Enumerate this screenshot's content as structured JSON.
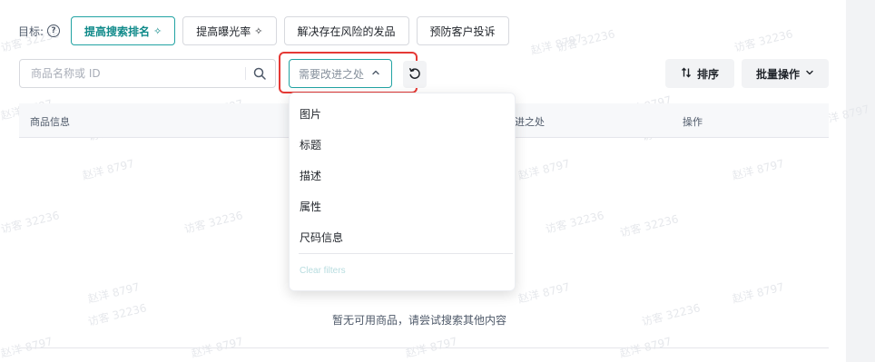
{
  "goal": {
    "label": "目标:",
    "buttons": [
      {
        "label": "提高搜索排名",
        "active": true
      },
      {
        "label": "提高曝光率",
        "active": false
      },
      {
        "label": "解决存在风险的发品",
        "active": false
      },
      {
        "label": "预防客户投诉",
        "active": false
      }
    ]
  },
  "search": {
    "placeholder": "商品名称或 ID"
  },
  "improve_filter": {
    "placeholder": "需要改进之处",
    "options": [
      "图片",
      "标题",
      "描述",
      "属性",
      "尺码信息"
    ],
    "clear_label": "Clear filters"
  },
  "toolbar": {
    "sort_label": "排序",
    "batch_label": "批量操作"
  },
  "table": {
    "columns": [
      "商品信息",
      "进之处",
      "操作"
    ]
  },
  "empty_state": {
    "text": "暂无可用商品，请尝试搜索其他内容"
  },
  "watermark": {
    "items": [
      "赵洋 8797",
      "访客 32236"
    ]
  },
  "colors": {
    "accent": "#21a3a3",
    "highlight": "#e53935"
  },
  "icons": {
    "help": "help-circle-icon",
    "spark": "sparkle-icon",
    "search": "search-icon",
    "chevron": "chevron-up-icon",
    "reset": "refresh-icon",
    "sort": "sort-icon",
    "batch_chevron": "chevron-down-icon"
  }
}
